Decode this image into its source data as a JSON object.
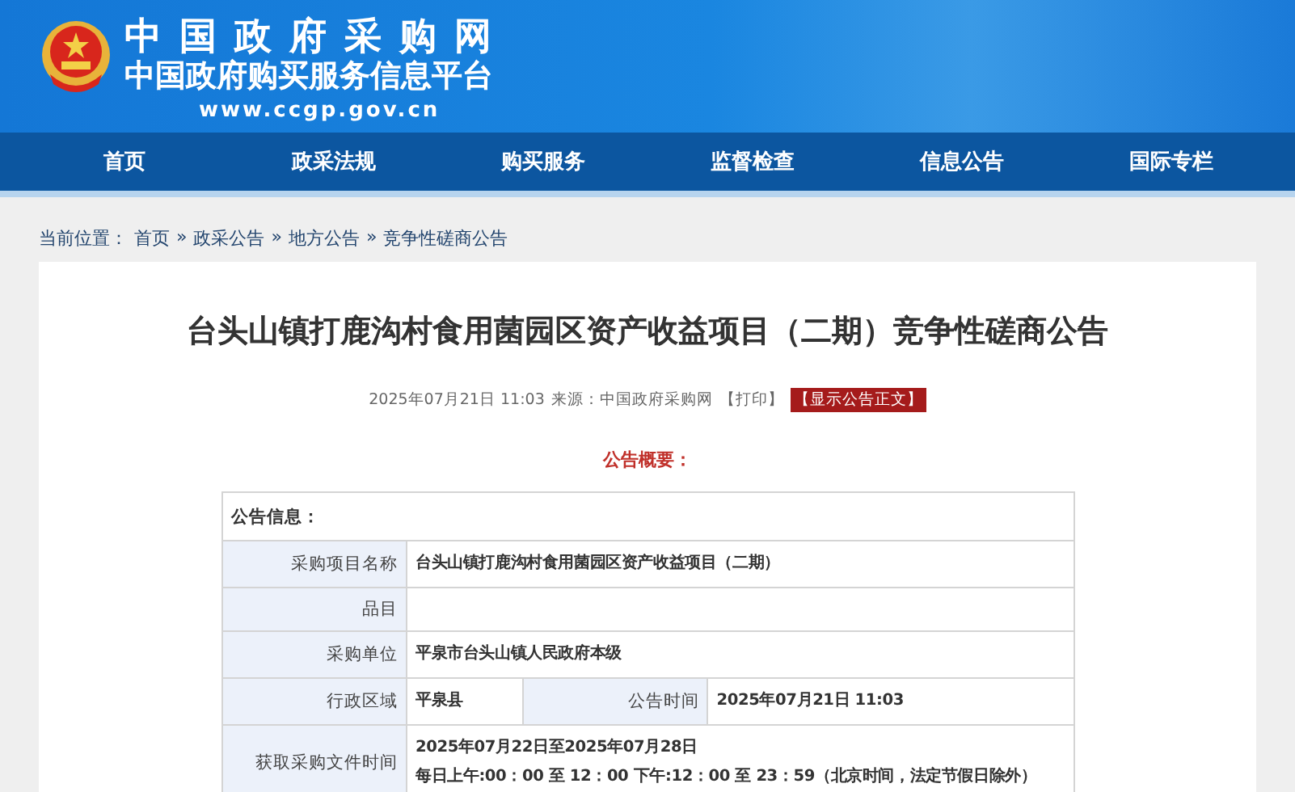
{
  "header": {
    "title": "中国政府采购网",
    "subtitle": "中国政府购买服务信息平台",
    "url": "www.ccgp.gov.cn"
  },
  "nav": {
    "items": [
      "首页",
      "政采法规",
      "购买服务",
      "监督检查",
      "信息公告",
      "国际专栏"
    ]
  },
  "breadcrumb": {
    "label": "当前位置：",
    "items": [
      {
        "text": "首页",
        "sep": "»"
      },
      {
        "text": "政采公告",
        "sep": "»"
      },
      {
        "text": "地方公告",
        "sep": "»"
      },
      {
        "text": "竞争性磋商公告"
      }
    ]
  },
  "article": {
    "title": "台头山镇打鹿沟村食用菌园区资产收益项目（二期）竞争性磋商公告",
    "date": "2025年07月21日 11:03",
    "source": "来源：中国政府采购网",
    "print": "【打印】",
    "show_body": "【显示公告正文】",
    "summary_heading": "公告概要："
  },
  "table": {
    "section": "公告信息：",
    "rows": [
      {
        "cells": [
          {
            "label": "采购项目名称",
            "value": [
              "台头山镇打鹿沟村食用菌园区资产收益项目（二期）"
            ]
          }
        ]
      },
      {
        "cells": [
          {
            "label": "品目"
          }
        ]
      },
      {
        "cells": [
          {
            "label": "采购单位",
            "value": [
              "平泉市台头山镇人民政府本级"
            ]
          }
        ]
      },
      {
        "cells": [
          {
            "label": "行政区域",
            "value": [
              "平泉县"
            ]
          },
          {
            "label": "公告时间",
            "value": [
              "2025年07月21日 11:03"
            ]
          }
        ]
      },
      {
        "cells": [
          {
            "label": "获取采购文件时间",
            "value": [
              "2025年07月22日至2025年07月28日",
              "每日上午:00：00 至 12：00  下午:12：00 至 23：59（北京时间，法定节假日除外）"
            ]
          }
        ]
      }
    ]
  }
}
